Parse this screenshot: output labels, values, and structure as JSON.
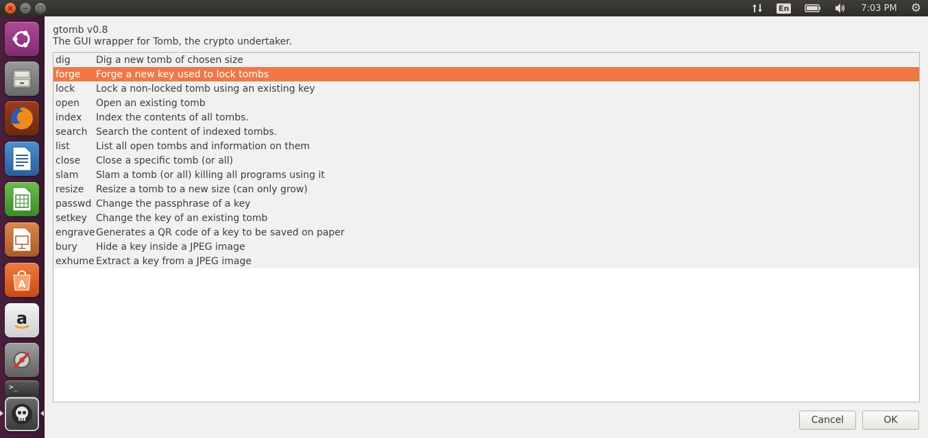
{
  "window": {
    "controls": [
      "close",
      "minimize",
      "maximize"
    ]
  },
  "panel": {
    "keyboard_layout": "En",
    "clock": "7:03 PM"
  },
  "launcher": {
    "items": [
      {
        "name": "ubuntu-dash",
        "color": "#8b3a8b"
      },
      {
        "name": "files",
        "color": "#7f7f7f"
      },
      {
        "name": "firefox",
        "color": "#d6541a"
      },
      {
        "name": "libreoffice-writer",
        "color": "#2a6fb0"
      },
      {
        "name": "libreoffice-calc",
        "color": "#3a9a3a"
      },
      {
        "name": "libreoffice-impress",
        "color": "#c2662a"
      },
      {
        "name": "software-center",
        "color": "#e05d24"
      },
      {
        "name": "amazon",
        "color": "#e8e8e8"
      },
      {
        "name": "system-settings",
        "color": "#8a8a8a"
      },
      {
        "name": "terminal",
        "color": "#3a3a3a"
      },
      {
        "name": "gtomb",
        "color": "#4a4a4a"
      }
    ]
  },
  "dialog": {
    "title": "gtomb v0.8",
    "subtitle": "The GUI wrapper for Tomb, the crypto undertaker.",
    "selected_command": "forge",
    "commands": [
      {
        "cmd": "dig",
        "desc": "Dig a new tomb of chosen size"
      },
      {
        "cmd": "forge",
        "desc": "Forge a new key used to lock tombs"
      },
      {
        "cmd": "lock",
        "desc": "Lock a non-locked tomb using an existing key"
      },
      {
        "cmd": "open",
        "desc": "Open an existing tomb"
      },
      {
        "cmd": "index",
        "desc": "Index the contents of all tombs."
      },
      {
        "cmd": "search",
        "desc": "Search the content of indexed tombs."
      },
      {
        "cmd": "list",
        "desc": "List all open tombs and information on them"
      },
      {
        "cmd": "close",
        "desc": "Close a specific tomb (or all)"
      },
      {
        "cmd": "slam",
        "desc": "Slam a tomb (or all) killing all programs using it"
      },
      {
        "cmd": "resize",
        "desc": "Resize a tomb to a new size (can only grow)"
      },
      {
        "cmd": "passwd",
        "desc": "Change the passphrase of a key"
      },
      {
        "cmd": "setkey",
        "desc": "Change the key of an existing tomb"
      },
      {
        "cmd": "engrave",
        "desc": "Generates a QR code of a key to be saved on paper"
      },
      {
        "cmd": "bury",
        "desc": "Hide a key inside a JPEG image"
      },
      {
        "cmd": "exhume",
        "desc": "Extract a key from a JPEG image"
      }
    ],
    "cancel_label": "Cancel",
    "ok_label": "OK"
  },
  "colors": {
    "selection": "#f07746",
    "launcher_bg": "#4a1f3c",
    "panel_bg": "#3c3b37"
  }
}
